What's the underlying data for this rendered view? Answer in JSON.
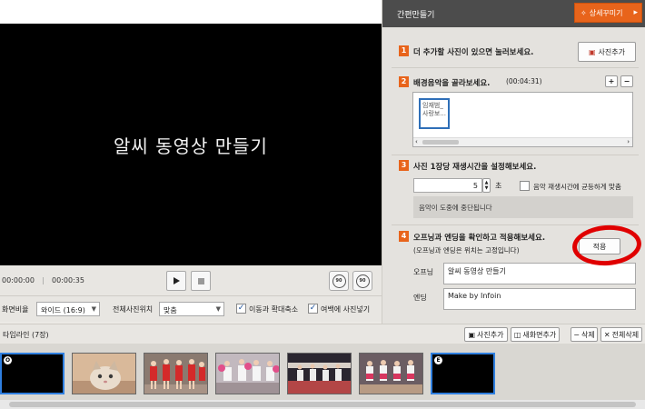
{
  "preview": {
    "title": "알씨 동영상 만들기"
  },
  "playback": {
    "current_time": "00:00:00",
    "total_time": "00:00:35",
    "separator": "|",
    "play_icon": "play-icon",
    "stop_icon": "stop-icon",
    "rotate_left_label": "90",
    "rotate_right_label": "90"
  },
  "options": {
    "aspect_label": "화면비율",
    "aspect_value": "와이드 (16:9)",
    "position_label": "전체사진위치",
    "position_value": "맞춤",
    "move_zoom_label": "이동과 확대축소",
    "move_zoom_checked": true,
    "margin_label": "여백에 사진넣기",
    "margin_checked": true
  },
  "panel": {
    "title": "간편만들기",
    "detail_button": "상세꾸미기",
    "step1": {
      "num": "1",
      "text": "더 추가할 사진이 있으면 눌러보세요.",
      "button": "사진추가"
    },
    "step2": {
      "num": "2",
      "text": "배경음악을 골라보세요.",
      "duration": "(00:04:31)",
      "plus": "+",
      "minus": "−",
      "item": "임재범_사랑보..."
    },
    "step3": {
      "num": "3",
      "text": "사진 1장당 재생시간을 설정해보세요.",
      "seconds": "5",
      "unit": "초",
      "fit_label": "음악 재생시간에 균등하게 맞춤",
      "fit_checked": false,
      "notice": "음악이 도중에 중단됩니다"
    },
    "step4": {
      "num": "4",
      "text": "오프닝과 엔딩을 확인하고 적용해보세요.",
      "sub": "(오프닝과 엔딩은 위치는 고정입니다)",
      "apply": "적용",
      "opening_label": "오프닝",
      "opening_value": "알씨 동영상 만들기",
      "ending_label": "엔딩",
      "ending_value": "Make by Infoin"
    }
  },
  "timeline": {
    "label": "타임라인 (7장)",
    "add_photo": "사진추가",
    "add_new_screen": "새화면추가",
    "delete": "삭제",
    "delete_all": "전체삭제",
    "items": [
      {
        "badge": "O",
        "kind": "opening"
      },
      {
        "badge": "",
        "kind": "kitten"
      },
      {
        "badge": "",
        "kind": "cheer-red"
      },
      {
        "badge": "",
        "kind": "cheer-white"
      },
      {
        "badge": "",
        "kind": "stage"
      },
      {
        "badge": "",
        "kind": "cheer-court"
      },
      {
        "badge": "E",
        "kind": "ending"
      }
    ]
  },
  "colors": {
    "accent": "#e8641b",
    "selection": "#2f7fe0",
    "annotation": "#e00000"
  }
}
